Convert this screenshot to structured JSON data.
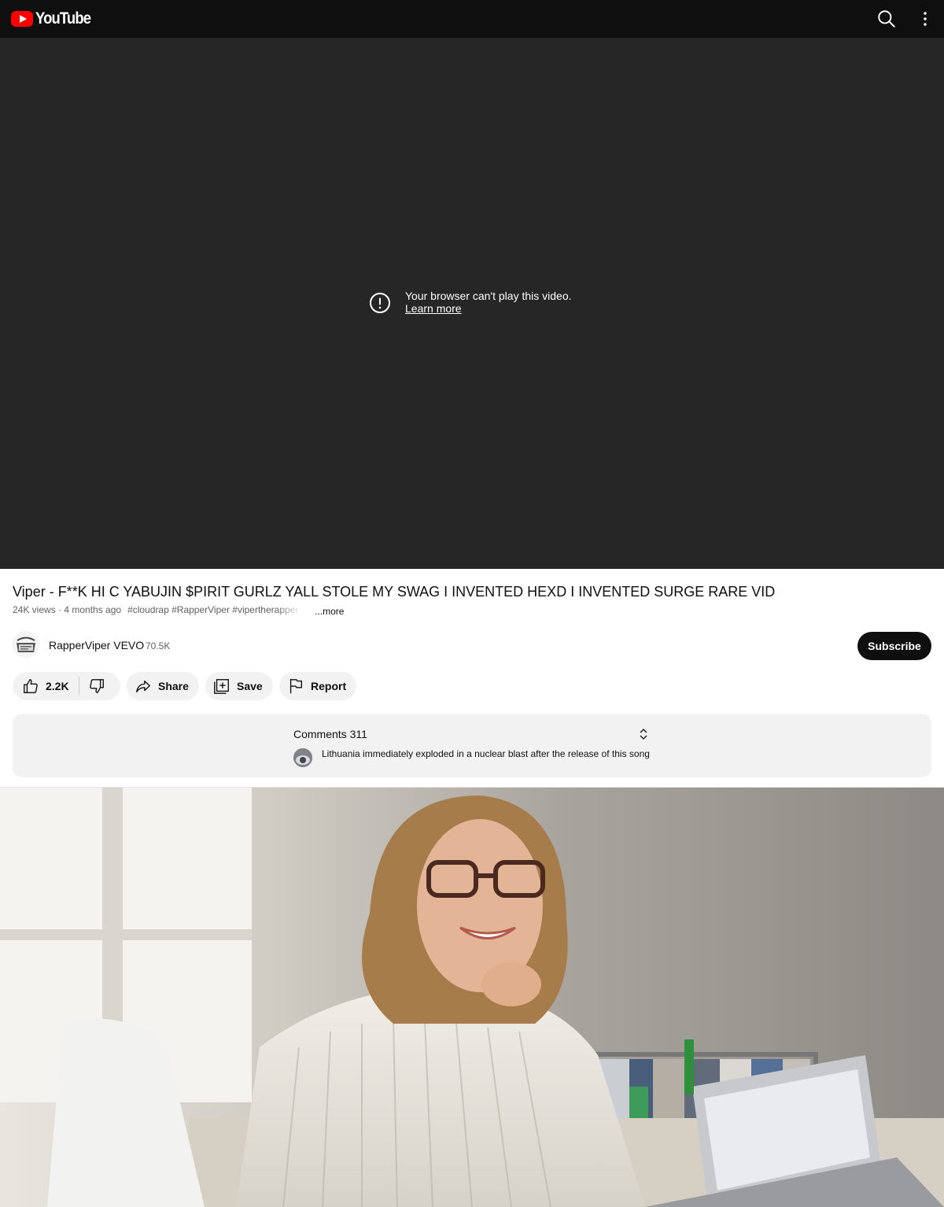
{
  "header": {
    "logo_text": "YouTube",
    "icons": [
      "youtube-logo-icon",
      "search-icon",
      "more-vert-icon"
    ]
  },
  "player": {
    "error_message": "Your browser can't play this video.",
    "learn_more": "Learn more"
  },
  "video": {
    "title": "Viper - F**K HI C YABUJIN $PIRIT GURLZ YALL STOLE MY SWAG I INVENTED HEXD I INVENTED SURGE RARE VID",
    "views_and_date": "24K views · 4 months ago",
    "hashtags": "#cloudrap #RapperViper #vipertherapper",
    "more_label": "...more"
  },
  "channel": {
    "name": "RapperViper VEVO",
    "subscribers": "70.5K",
    "subscribe_label": "Subscribe"
  },
  "actions": {
    "like_count": "2.2K",
    "share_label": "Share",
    "save_label": "Save",
    "report_label": "Report"
  },
  "comments": {
    "header": "Comments 311",
    "top_comment": "Lithuania immediately exploded in a nuclear blast after the release of this song"
  },
  "colors": {
    "topbar_bg": "#0f0f0f",
    "player_bg": "#262626",
    "brand_red": "#ff0000",
    "pill_bg": "#f2f2f2",
    "subscribe_bg": "#0f0f0f"
  }
}
